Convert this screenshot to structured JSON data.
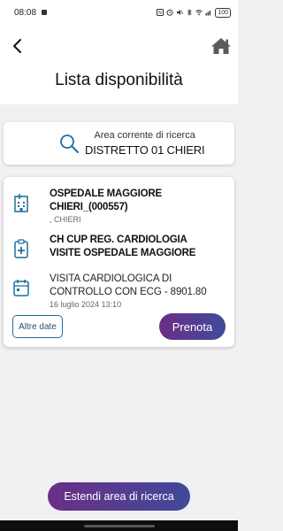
{
  "status_bar": {
    "time": "08:08",
    "battery": "100"
  },
  "header": {
    "title": "Lista disponibilità",
    "back_icon": "chevron-left-icon",
    "home_icon": "home-icon"
  },
  "search_area": {
    "label": "Area corrente di ricerca",
    "value": "DISTRETTO 01 CHIERI",
    "icon": "search-icon"
  },
  "result_card": {
    "hospital": {
      "icon": "hospital-building-icon",
      "name_line1": "OSPEDALE MAGGIORE",
      "name_line2": "CHIERI_(000557)",
      "city": ", CHIERI"
    },
    "service": {
      "icon": "clipboard-plus-icon",
      "line1": "CH CUP REG. CARDIOLOGIA",
      "line2": "VISITE OSPEDALE MAGGIORE"
    },
    "appointment": {
      "icon": "calendar-icon",
      "line1": "VISITA CARDIOLOGICA DI",
      "line2": "CONTROLLO CON ECG - 8901.80",
      "datetime": "16 luglio 2024 13:10"
    },
    "other_dates_label": "Altre date",
    "book_label": "Prenota"
  },
  "extend_button_label": "Estendi area di ricerca",
  "colors": {
    "accent_blue": "#1f6fa0",
    "gradient_start": "#6b2f86",
    "gradient_end": "#3f4a9a",
    "background": "#f1f1f3"
  }
}
